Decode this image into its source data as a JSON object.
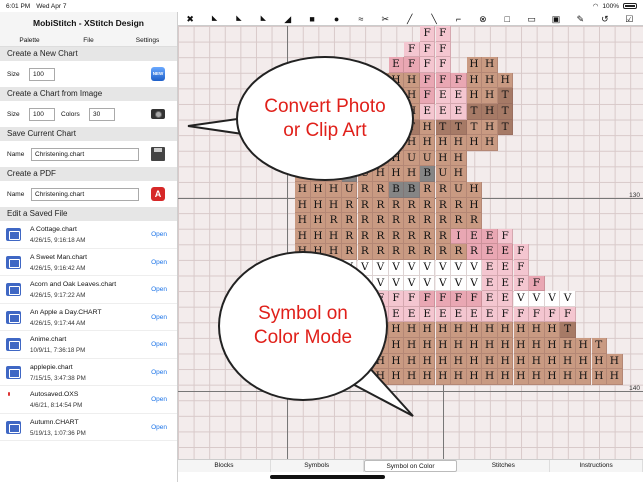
{
  "status": {
    "time": "6:01 PM",
    "date": "Wed Apr 7",
    "battery": "100%"
  },
  "sidebar": {
    "title": "MobiStitch - XStitch Design",
    "segments": [
      "Palette",
      "File",
      "Settings"
    ],
    "create_new": {
      "header": "Create a New Chart",
      "size_label": "Size",
      "size_value": "100",
      "icon": "new-icon"
    },
    "create_image": {
      "header": "Create a Chart from Image",
      "size_label": "Size",
      "size_value": "100",
      "colors_label": "Colors",
      "colors_value": "30",
      "icon": "camera-icon"
    },
    "save": {
      "header": "Save Current Chart",
      "name_label": "Name",
      "name_value": "Christening.chart",
      "icon": "floppy-disk-icon"
    },
    "pdf": {
      "header": "Create a PDF",
      "name_label": "Name",
      "name_value": "Christening.chart",
      "icon": "pdf-icon"
    },
    "edit": {
      "header": "Edit a Saved File",
      "open_label": "Open"
    },
    "files": [
      {
        "name": "A Cottage.chart",
        "date": "4/26/15, 9:16:18 AM"
      },
      {
        "name": "A Sweet Man.chart",
        "date": "4/26/15, 9:16:42 AM"
      },
      {
        "name": "Acorn and Oak Leaves.chart",
        "date": "4/26/15, 9:17:22 AM"
      },
      {
        "name": "An Apple a Day.CHART",
        "date": "4/26/15, 9:17:44 AM"
      },
      {
        "name": "Anime.chart",
        "date": "10/9/11, 7:36:18 PM"
      },
      {
        "name": "applepie.chart",
        "date": "7/15/15, 3:47:38 PM"
      },
      {
        "name": "Autosaved.OXS",
        "date": "4/6/21, 8:14:54 PM"
      },
      {
        "name": "Autumn.CHART",
        "date": "5/19/13, 1:07:36 PM"
      }
    ]
  },
  "toolbar": {
    "tools": [
      "close-icon",
      "arrow-icon",
      "arrow-icon",
      "arrow-icon",
      "half-square-icon",
      "square-icon",
      "circle-icon",
      "fill-icon",
      "eraser-icon",
      "line-icon",
      "diagonal-line-icon",
      "corner-icon",
      "stop-icon",
      "select-rect-icon",
      "select-icon",
      "image-icon",
      "eyedropper-icon",
      "rotate-icon",
      "check-icon"
    ]
  },
  "chart": {
    "axis_labels": [
      "130",
      "140"
    ],
    "bubble1": "Convert Photo\nor Clip Art",
    "bubble2": "Symbol on\nColor Mode",
    "colors": {
      "light_pink": "#f4c6d0",
      "pink": "#e9a7b3",
      "tan": "#c99a82",
      "dark_tan": "#a67a66",
      "gray": "#858585",
      "white": "#ffffff"
    }
  },
  "tabs": {
    "items": [
      "Blocks",
      "Symbols",
      "Symbol on Color",
      "Stitches",
      "Instructions"
    ],
    "active": "Symbol on Color"
  }
}
